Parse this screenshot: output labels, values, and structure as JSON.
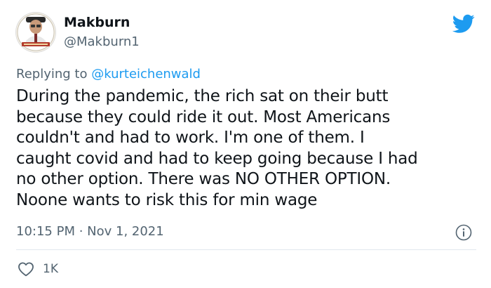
{
  "author": {
    "name": "Makburn",
    "handle": "@Makburn1"
  },
  "reply": {
    "prefix": "Replying to ",
    "mention": "@kurteichenwald"
  },
  "body_lines": [
    "During the pandemic, the rich sat on their butt",
    "because they could ride it out. Most Americans",
    "couldn't and had to work. I'm one of them. I",
    "caught covid and had to keep going because I had",
    "no other option. There was NO OTHER OPTION.",
    "Noone wants to risk this for min wage"
  ],
  "meta": {
    "time": "10:15 PM",
    "separator": " · ",
    "date": "Nov 1, 2021"
  },
  "likes": {
    "count": "1K"
  },
  "icons": {
    "brand": "twitter-bird-icon",
    "info": "info-icon",
    "like": "heart-icon"
  },
  "colors": {
    "brand_blue": "#1d9bf0",
    "muted_text": "#536471",
    "main_text": "#0f1419"
  }
}
